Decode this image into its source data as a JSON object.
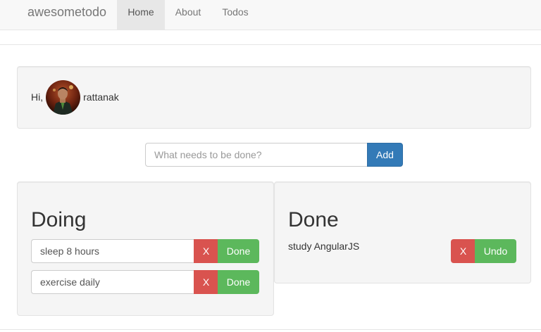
{
  "navbar": {
    "brand": "awesometodo",
    "items": [
      {
        "label": "Home",
        "active": true
      },
      {
        "label": "About",
        "active": false
      },
      {
        "label": "Todos",
        "active": false
      }
    ]
  },
  "greeting": {
    "prefix": "Hi,",
    "username": "rattanak"
  },
  "new_todo": {
    "placeholder": "What needs to be done?",
    "value": "",
    "add_label": "Add"
  },
  "doing": {
    "title": "Doing",
    "items": [
      {
        "text": "sleep 8 hours",
        "remove_label": "X",
        "done_label": "Done"
      },
      {
        "text": "exercise daily",
        "remove_label": "X",
        "done_label": "Done"
      }
    ]
  },
  "done": {
    "title": "Done",
    "items": [
      {
        "text": "study AngularJS",
        "remove_label": "X",
        "undo_label": "Undo"
      }
    ]
  },
  "colors": {
    "primary": "#337ab7",
    "danger": "#d9534f",
    "success": "#5cb85c",
    "well_bg": "#f5f5f5",
    "navbar_bg": "#f8f8f8"
  }
}
